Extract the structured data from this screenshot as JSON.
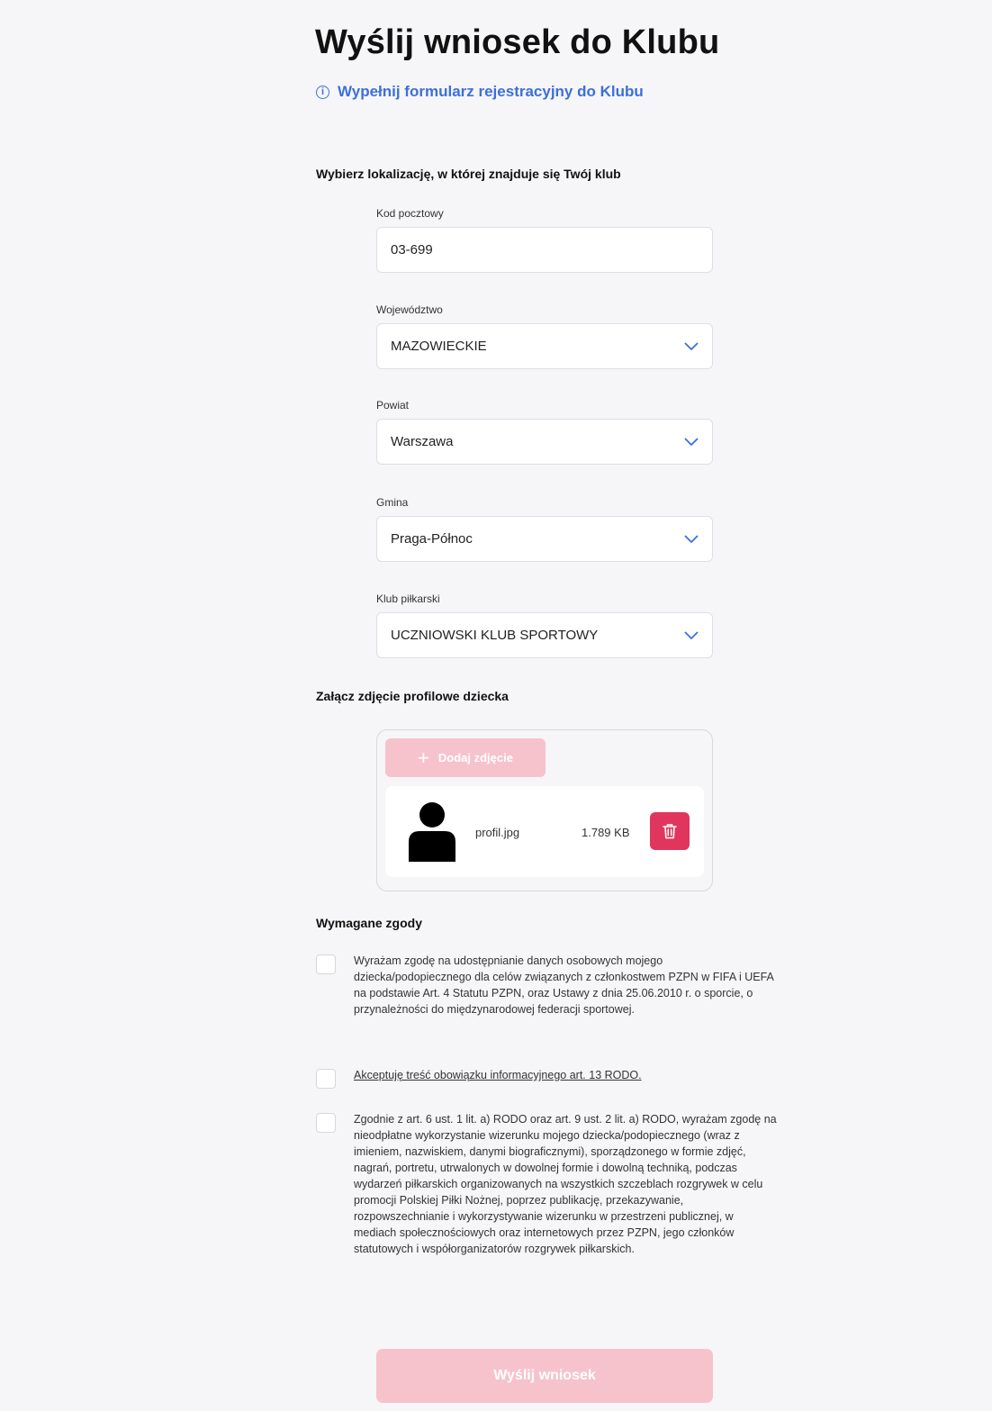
{
  "header": {
    "title": "Wyślij wniosek do Klubu",
    "subtitle": "Wypełnij formularz rejestracyjny do Klubu",
    "info_icon": "info-icon"
  },
  "location": {
    "heading": "Wybierz lokalizację, w której znajduje się Twój klub",
    "postal_code": {
      "label": "Kod pocztowy",
      "value": "03-699"
    },
    "voivodeship": {
      "label": "Województwo",
      "value": "MAZOWIECKIE"
    },
    "county": {
      "label": "Powiat",
      "value": "Warszawa"
    },
    "commune": {
      "label": "Gmina",
      "value": "Praga-Północ"
    },
    "club": {
      "label": "Klub piłkarski",
      "value": "UCZNIOWSKI KLUB SPORTOWY"
    }
  },
  "photo": {
    "heading": "Załącz zdjęcie profilowe dziecka",
    "add_button_label": "Dodaj zdjęcie",
    "add_button_icon": "plus-icon",
    "file": {
      "name": "profil.jpg",
      "size": "1.789 KB",
      "thumbnail_icon": "person-silhouette-icon",
      "delete_icon": "trash-icon"
    }
  },
  "consents": {
    "heading": "Wymagane zgody",
    "items": [
      {
        "text": "Wyrażam zgodę na udostępnianie danych osobowych mojego dziecka/podopiecznego dla celów związanych z członkostwem PZPN w FIFA i UEFA na podstawie Art. 4 Statutu PZPN, oraz Ustawy z dnia 25.06.2010 r. o sporcie, o przynależności do międzynarodowej federacji sportowej.",
        "checked": false
      },
      {
        "text": "Akceptuję treść obowiązku informacyjnego art. 13 RODO.",
        "checked": false
      },
      {
        "text": "Zgodnie z art. 6 ust. 1 lit. a) RODO oraz art. 9 ust. 2 lit. a) RODO, wyrażam zgodę na nieodpłatne wykorzystanie wizerunku mojego dziecka/podopiecznego (wraz z imieniem, nazwiskiem, danymi biograficznymi), sporządzonego w formie zdjęć, nagrań, portretu, utrwalonych w dowolnej formie i dowolną techniką, podczas wydarzeń piłkarskich organizowanych na wszystkich szczeblach rozgrywek w celu promocji Polskiej Piłki Nożnej, poprzez publikację, przekazywanie, rozpowszechnianie i wykorzystywanie wizerunku w przestrzeni publicznej, w mediach społecznościowych oraz internetowych przez PZPN, jego członków statutowych i współorganizatorów rozgrywek piłkarskich.",
        "checked": false
      }
    ]
  },
  "submit": {
    "label": "Wyślij wniosek"
  },
  "colors": {
    "accent_blue": "#3d6fd9",
    "disabled_pink": "#f6c3cd",
    "danger_red": "#e0365d",
    "background": "#f6f6f8"
  }
}
